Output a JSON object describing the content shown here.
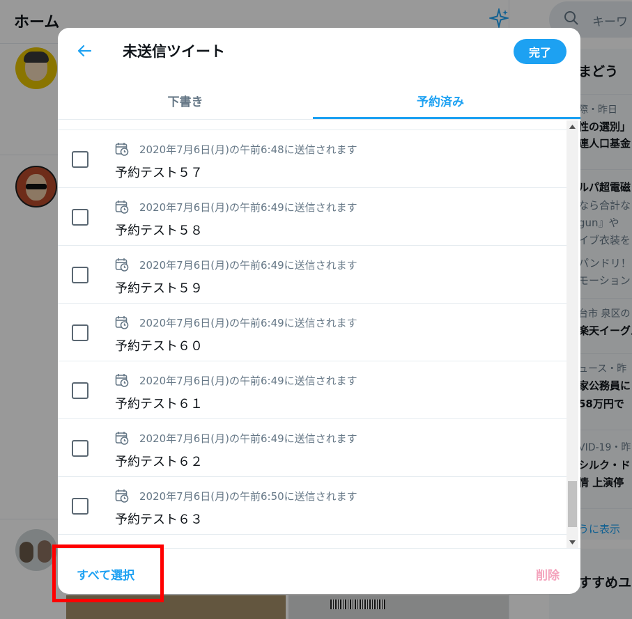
{
  "background": {
    "home_title": "ホーム",
    "search_placeholder": "キーワ",
    "trends_heading": "まどう",
    "trends": [
      {
        "meta": "際・昨日",
        "line1": "性の選別」",
        "line2": "連人口基金"
      },
      {
        "line1": "ルパ超電磁",
        "line2": "なら合計な",
        "line3": "gun』や",
        "line4": "イブ衣装を",
        "line5": "パンドリ！",
        "line6": "モーション"
      },
      {
        "meta": "台市 泉区の",
        "line1": "楽天イーグル"
      },
      {
        "meta": "ュース・昨",
        "line1": "家公務員に",
        "line2": "58万円で"
      },
      {
        "meta": "VID-19・昨",
        "line1": "シルク・ド",
        "line2": "情 上演停"
      }
    ],
    "show_more": "うに表示",
    "recommend_heading": "すすめユ"
  },
  "modal": {
    "title": "未送信ツイート",
    "done_label": "完了",
    "tabs": [
      {
        "label": "下書き",
        "active": false
      },
      {
        "label": "予約済み",
        "active": true
      }
    ],
    "items": [
      {
        "schedule": "2020年7月6日(月)の午前6:48に送信されます",
        "text": "予約テスト５７",
        "checked": false
      },
      {
        "schedule": "2020年7月6日(月)の午前6:49に送信されます",
        "text": "予約テスト５８",
        "checked": false
      },
      {
        "schedule": "2020年7月6日(月)の午前6:49に送信されます",
        "text": "予約テスト５９",
        "checked": false
      },
      {
        "schedule": "2020年7月6日(月)の午前6:49に送信されます",
        "text": "予約テスト６０",
        "checked": false
      },
      {
        "schedule": "2020年7月6日(月)の午前6:49に送信されます",
        "text": "予約テスト６１",
        "checked": false
      },
      {
        "schedule": "2020年7月6日(月)の午前6:49に送信されます",
        "text": "予約テスト６２",
        "checked": false
      },
      {
        "schedule": "2020年7月6日(月)の午前6:50に送信されます",
        "text": "予約テスト６３",
        "checked": false
      }
    ],
    "select_all_label": "すべて選択",
    "delete_label": "削除"
  },
  "colors": {
    "accent": "#1da1f2",
    "delete_disabled": "#f4a4bd",
    "highlight": "#ff0000"
  },
  "icons": {
    "back": "arrow-left-icon",
    "schedule": "calendar-clock-icon",
    "explore": "sparkle-icon",
    "search": "search-icon"
  }
}
